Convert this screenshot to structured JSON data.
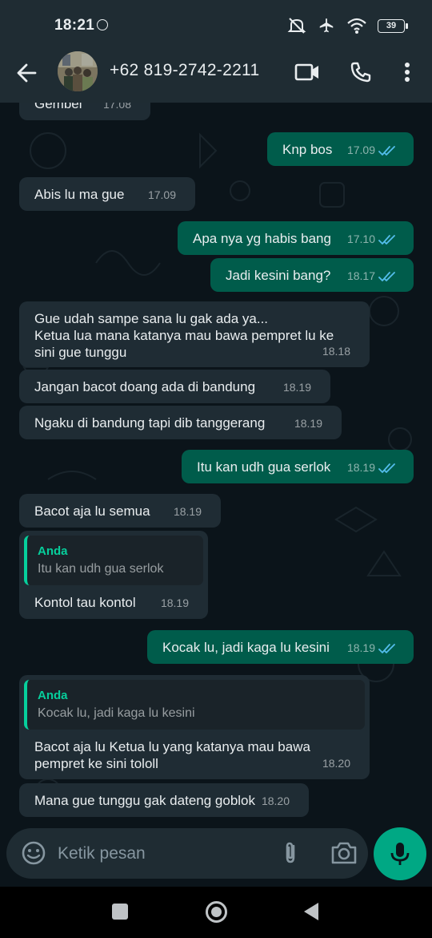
{
  "status_bar": {
    "time": "18:21",
    "battery": "39",
    "icons": [
      "facebook-notification-icon",
      "mute-icon",
      "airplane-icon",
      "wifi-icon",
      "battery-icon"
    ]
  },
  "header": {
    "contact": "+62 819-2742-2211",
    "icons": [
      "back-arrow-icon",
      "avatar",
      "video-call-icon",
      "phone-icon",
      "more-icon"
    ]
  },
  "messages": [
    {
      "dir": "in",
      "text": "Gembel",
      "time": "17.08"
    },
    {
      "dir": "out",
      "text": "Knp bos",
      "time": "17.09",
      "read": true
    },
    {
      "dir": "in",
      "text": "Abis lu ma gue",
      "time": "17.09"
    },
    {
      "dir": "out",
      "text": "Apa nya yg habis bang",
      "time": "17.10",
      "read": true
    },
    {
      "dir": "out",
      "text": "Jadi kesini bang?",
      "time": "18.17",
      "read": true
    },
    {
      "dir": "in",
      "lines": [
        "Gue udah sampe sana lu gak ada ya...",
        "Ketua lua mana katanya mau bawa pempret lu ke",
        "sini gue tunggu"
      ],
      "time": "18.18"
    },
    {
      "dir": "in",
      "text": "Jangan bacot doang ada di bandung",
      "time": "18.19"
    },
    {
      "dir": "in",
      "text": "Ngaku di bandung tapi dib tanggerang",
      "time": "18.19"
    },
    {
      "dir": "out",
      "text": "Itu kan udh gua serlok",
      "time": "18.19",
      "read": true
    },
    {
      "dir": "in",
      "text": "Bacot aja lu semua",
      "time": "18.19"
    },
    {
      "dir": "in",
      "quote": {
        "name": "Anda",
        "text": "Itu kan udh gua serlok"
      },
      "text": "Kontol tau kontol",
      "time": "18.19"
    },
    {
      "dir": "out",
      "text": "Kocak lu, jadi kaga lu kesini",
      "time": "18.19",
      "read": true
    },
    {
      "dir": "in",
      "quote": {
        "name": "Anda",
        "text": "Kocak lu, jadi kaga lu kesini"
      },
      "lines": [
        "Bacot aja lu Ketua lu yang katanya mau bawa",
        "pempret ke sini tololl"
      ],
      "time": "18.20"
    },
    {
      "dir": "in",
      "text": "Mana gue tunggu gak dateng goblok",
      "time": "18.20"
    }
  ],
  "composer": {
    "placeholder": "Ketik pesan",
    "icons": [
      "emoji-icon",
      "attach-icon",
      "camera-icon",
      "mic-icon"
    ]
  },
  "colors": {
    "background": "#0b141a",
    "bar": "#1f2c33",
    "incoming_bubble": "#1f2c34",
    "outgoing_bubble": "#005c4b",
    "accent": "#00a884",
    "quote_accent": "#06cf9c",
    "read_ticks": "#53bdeb"
  }
}
